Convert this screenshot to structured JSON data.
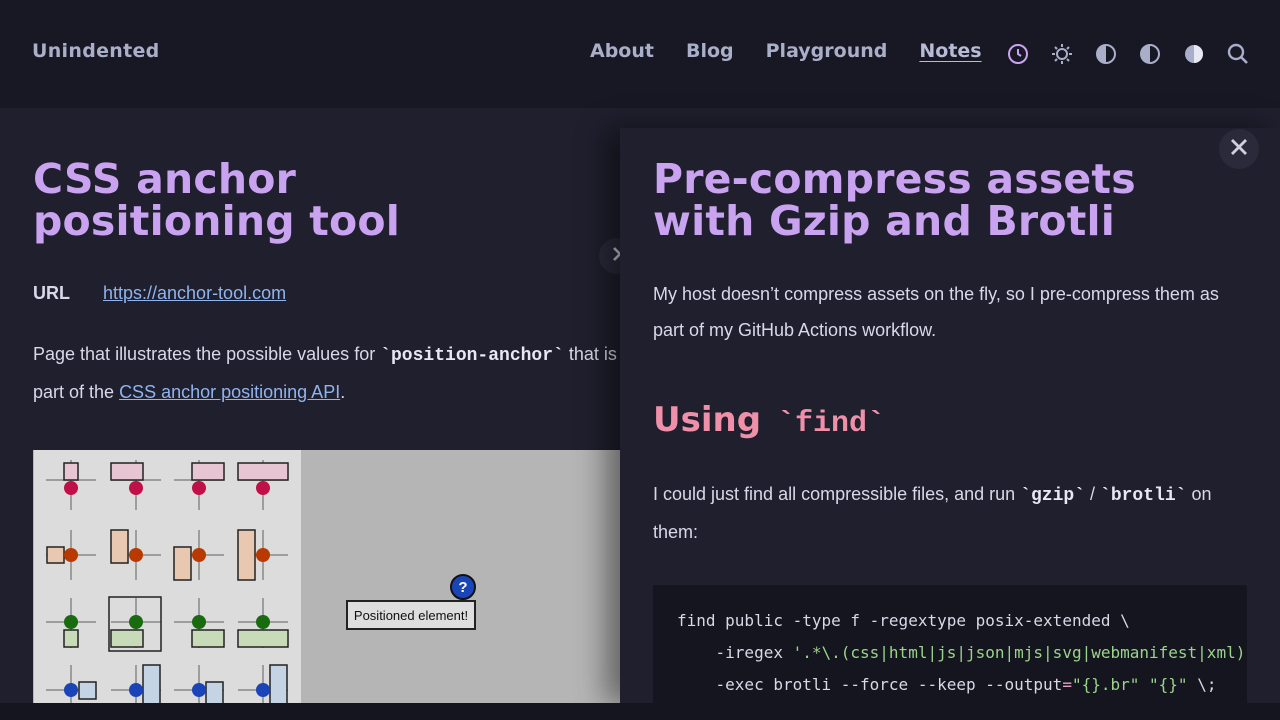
{
  "header": {
    "site_title": "Unindented",
    "nav": [
      {
        "label": "About"
      },
      {
        "label": "Blog"
      },
      {
        "label": "Playground"
      },
      {
        "label": "Notes",
        "active": true
      }
    ],
    "icons": [
      "clock-icon",
      "sun-icon",
      "half-circle-icon",
      "half-circle-icon",
      "half-circle-icon",
      "search-icon"
    ]
  },
  "left_note": {
    "title": "CSS anchor positioning tool",
    "url_label": "URL",
    "url": "https://anchor-tool.com",
    "para_pre": "Page that illustrates the possible values for ",
    "para_code": "`position-anchor`",
    "para_mid": " that is part of the ",
    "para_link": "CSS anchor positioning API",
    "para_post": ".",
    "image": {
      "positioned_label": "Positioned element!",
      "badge": "?"
    }
  },
  "right_note": {
    "title": "Pre-compress assets with Gzip and Brotli",
    "intro": "My host doesn’t compress assets on the fly, so I pre-compress them as part of my GitHub Actions workflow.",
    "section_title": "Using",
    "section_code": "`find`",
    "para_pre": "I could just find all compressible files, and run ",
    "code_gzip": "`gzip`",
    "para_sep": " / ",
    "code_brotli": "`brotli`",
    "para_post": " on them:",
    "code": {
      "line1": "find public -type f -regextype posix-extended \\",
      "line2_pre": "    -iregex ",
      "line2_str": "'.*\\.(css|html|js|json|mjs|svg|webmanifest|xml)'",
      "line3_pre": "    -exec brotli --force --keep --output",
      "line3_op": "=",
      "line3_str1": "\"{}.br\"",
      "line3_str2": "\"{}\"",
      "line3_post": " \\;"
    }
  },
  "colors": {
    "accent_title": "#c9a3f0",
    "heading_pink": "#ef8fa8",
    "link": "#8fb4ee",
    "background": "#1f1f2e"
  }
}
